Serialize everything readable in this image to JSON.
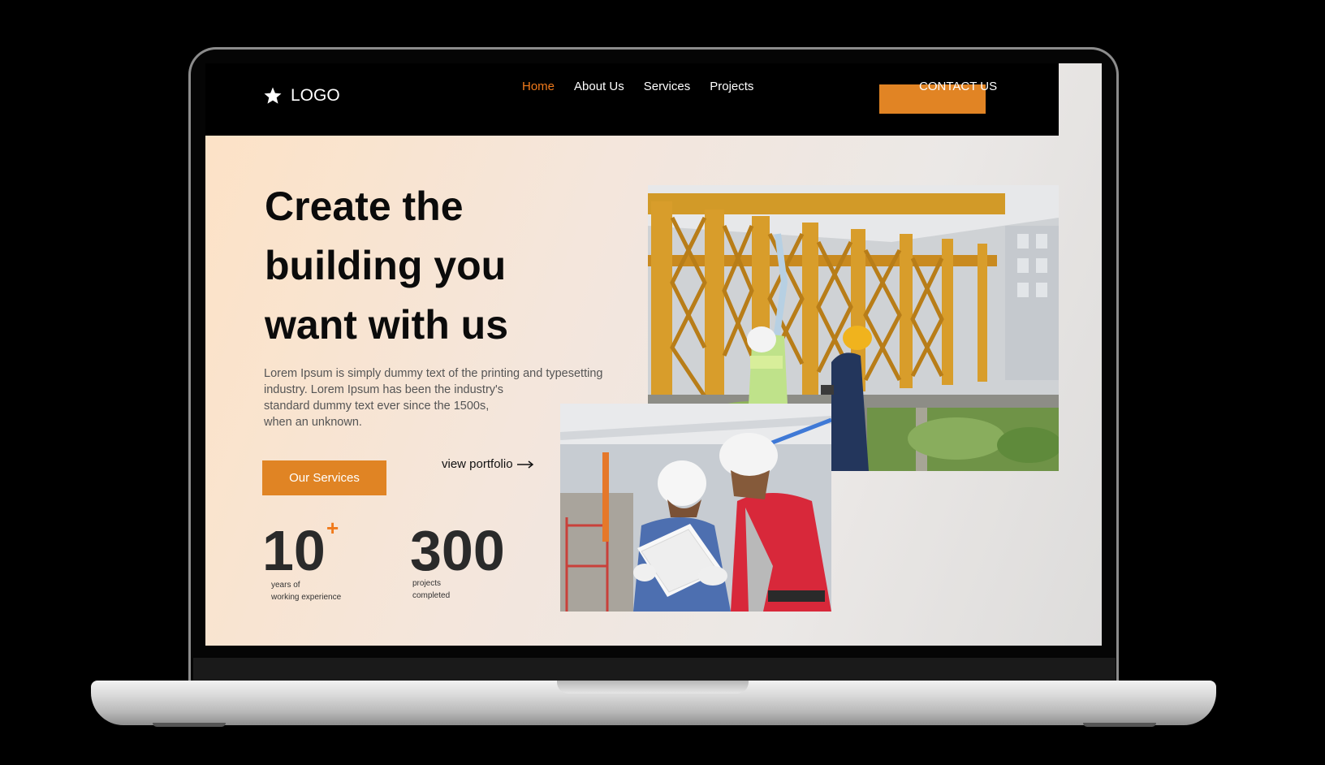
{
  "nav": {
    "logo_text": "LOGO",
    "links": [
      {
        "label": "Home",
        "active": true
      },
      {
        "label": "About Us",
        "active": false
      },
      {
        "label": "Services",
        "active": false
      },
      {
        "label": "Projects",
        "active": false
      }
    ],
    "contact_label": "CONTACT US"
  },
  "hero": {
    "title_lines": [
      "Create the",
      "building you",
      "want with us"
    ],
    "description_lines": [
      "Lorem Ipsum is simply dummy text of the printing and typesetting",
      "industry. Lorem Ipsum has been the industry's",
      "standard dummy text ever since the 1500s,",
      "when an unknown."
    ],
    "primary_button": "Our Services",
    "portfolio_link": "view portfolio"
  },
  "stats": [
    {
      "value": "10",
      "suffix": "+",
      "label_lines": [
        "years of",
        "working experience"
      ]
    },
    {
      "value": "300",
      "suffix": "",
      "label_lines": [
        "projects",
        "completed"
      ]
    }
  ],
  "icons": {
    "logo": "star-icon",
    "portfolio_arrow": "arrow-right-icon"
  },
  "colors": {
    "accent": "#E08424",
    "active_nav": "#F07A1B",
    "navbar": "#000000",
    "title": "#0B0B0B"
  }
}
